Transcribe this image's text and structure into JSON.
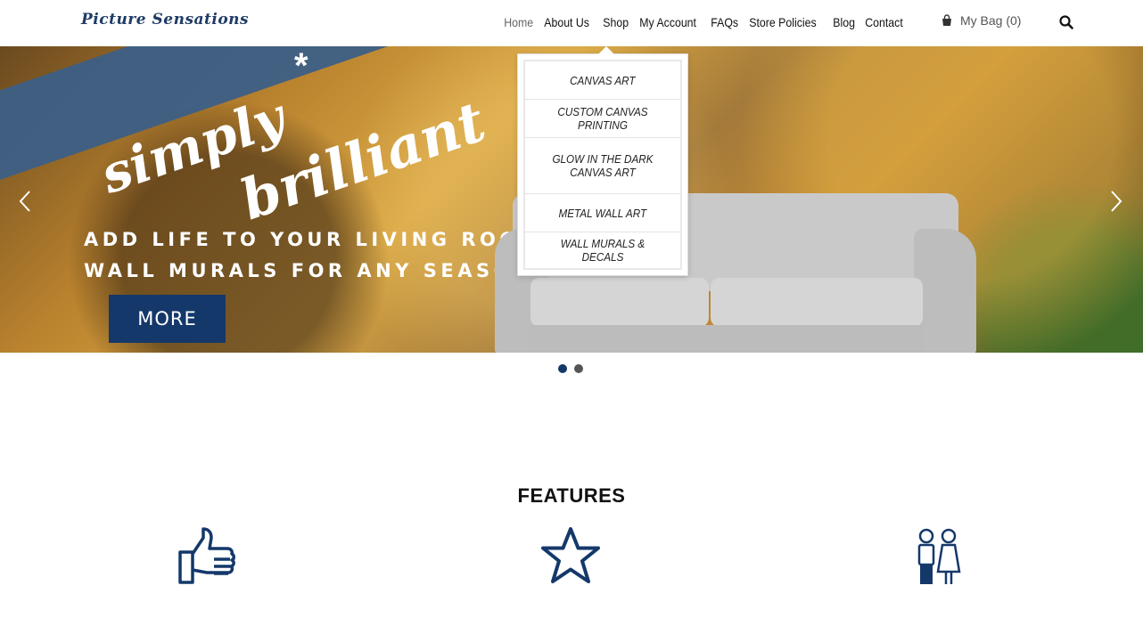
{
  "header": {
    "logo": "Picture Sensations",
    "nav": [
      {
        "label": "Home",
        "active": true
      },
      {
        "label": "About Us"
      },
      {
        "label": "Shop"
      },
      {
        "label": "My Account"
      },
      {
        "label": "FAQs"
      },
      {
        "label": "Store Policies"
      },
      {
        "label": "Blog"
      },
      {
        "label": "Contact"
      }
    ],
    "bag_label": "My Bag (0)",
    "bag_icon": "shopping-bag-icon",
    "search_icon": "search-icon"
  },
  "shop_dropdown": {
    "items": [
      "CANVAS ART",
      "CUSTOM CANVAS PRINTING",
      "GLOW IN THE DARK CANVAS ART",
      "METAL WALL ART",
      "WALL MURALS & DECALS"
    ]
  },
  "hero": {
    "script_line1": "simply",
    "script_line2": "brilliant",
    "asterisk": "*",
    "tagline1": "ADD LIFE TO YOUR LIVING ROOM",
    "tagline2": "WALL MURALS FOR ANY SEASON",
    "button": "MORE",
    "accent": "#14386a",
    "ribbon_color": "#3c5f86"
  },
  "carousel": {
    "slides": 2,
    "active": 1
  },
  "features": {
    "title": "FEATURES",
    "icons": [
      "thumbs-up-icon",
      "star-icon",
      "couple-icon"
    ],
    "icon_color": "#14386a"
  }
}
